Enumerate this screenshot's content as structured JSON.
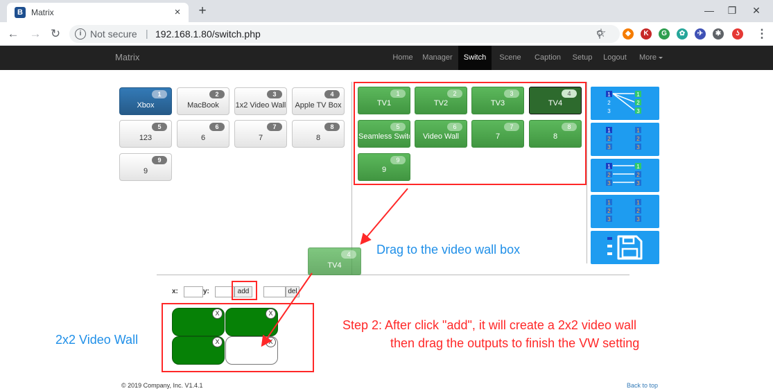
{
  "browser": {
    "tab_title": "Matrix",
    "tab_favicon_letter": "B",
    "tab_close": "×",
    "new_tab": "+",
    "security_label": "Not secure",
    "url_separator": "|",
    "url": "192.168.1.80/switch.php",
    "extensions": [
      {
        "name": "ext-diamond-icon",
        "color": "#f57c00",
        "glyph": "◆"
      },
      {
        "name": "ext-k-icon",
        "color": "#c62828",
        "glyph": "K"
      },
      {
        "name": "ext-g-icon",
        "color": "#2e9e4f",
        "glyph": "G"
      },
      {
        "name": "ext-flower-icon",
        "color": "#26a69a",
        "glyph": "✿"
      },
      {
        "name": "ext-compass-icon",
        "color": "#3f51b5",
        "glyph": "✈"
      },
      {
        "name": "ext-puzzle-icon",
        "color": "#5f6368",
        "glyph": "✱"
      },
      {
        "name": "ext-swirl-icon",
        "color": "#e53935",
        "glyph": "ʖ"
      }
    ]
  },
  "navbar": {
    "brand": "Matrix",
    "items": [
      {
        "label": "Home",
        "active": false
      },
      {
        "label": "Manager",
        "active": false
      },
      {
        "label": "Switch",
        "active": true
      },
      {
        "label": "Scene",
        "active": false
      },
      {
        "label": "Caption",
        "active": false
      },
      {
        "label": "Setup",
        "active": false
      },
      {
        "label": "Logout",
        "active": false
      },
      {
        "label": "More",
        "active": false
      }
    ]
  },
  "inputs": [
    {
      "num": "1",
      "label": "Xbox",
      "selected": true
    },
    {
      "num": "2",
      "label": "MacBook",
      "selected": false
    },
    {
      "num": "3",
      "label": "1x2 Video Wall",
      "selected": false
    },
    {
      "num": "4",
      "label": "Apple TV Box",
      "selected": false
    },
    {
      "num": "5",
      "label": "123",
      "selected": false
    },
    {
      "num": "6",
      "label": "6",
      "selected": false
    },
    {
      "num": "7",
      "label": "7",
      "selected": false
    },
    {
      "num": "8",
      "label": "8",
      "selected": false
    },
    {
      "num": "9",
      "label": "9",
      "selected": false
    }
  ],
  "outputs": [
    {
      "num": "1",
      "label": "TV1",
      "selected": false
    },
    {
      "num": "2",
      "label": "TV2",
      "selected": false
    },
    {
      "num": "3",
      "label": "TV3",
      "selected": false
    },
    {
      "num": "4",
      "label": "TV4",
      "selected": true
    },
    {
      "num": "5",
      "label": "Seamless Switch",
      "selected": false
    },
    {
      "num": "6",
      "label": "Video Wall",
      "selected": false
    },
    {
      "num": "7",
      "label": "7",
      "selected": false
    },
    {
      "num": "8",
      "label": "8",
      "selected": false
    },
    {
      "num": "9",
      "label": "9",
      "selected": false
    }
  ],
  "mode_labels": [
    "1",
    "2",
    "3"
  ],
  "dragged_tile": {
    "num": "4",
    "label": "TV4"
  },
  "wall_form": {
    "x_label": "x:",
    "y_label": "y:",
    "x_value": "",
    "y_value": "",
    "del_value": "",
    "add_label": "add",
    "del_label": "del"
  },
  "wall": {
    "remove_glyph": "X",
    "cells": [
      {
        "filled": true
      },
      {
        "filled": true
      },
      {
        "filled": true
      },
      {
        "filled": false
      }
    ]
  },
  "annotations": {
    "drag_hint": "Drag to the video wall box",
    "wall_label": "2x2 Video Wall",
    "step2_line1": "Step 2: After click \"add\", it will create a 2x2 video wall",
    "step2_line2": "then drag the outputs to finish the VW setting"
  },
  "footer": {
    "copyright": "© 2019 Company, Inc. V1.4.1",
    "back_to_top": "Back to top"
  },
  "colors": {
    "annotation_red": "#ff2828",
    "annotation_blue": "#1f8fe8",
    "output_green": "#5cb85c",
    "input_selected_blue": "#337ab7",
    "mode_button_blue": "#1e9cf0",
    "wall_cell_green": "#068106",
    "navbar_bg": "#222222"
  }
}
